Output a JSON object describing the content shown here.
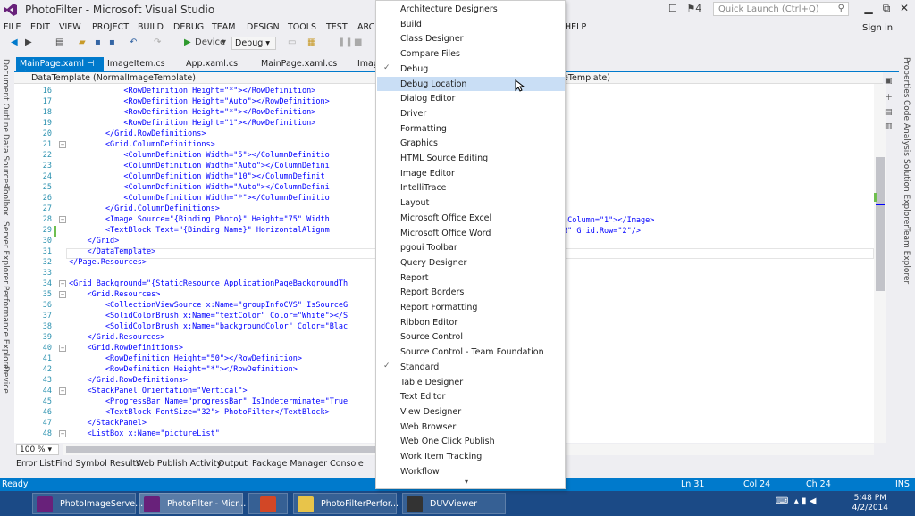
{
  "window": {
    "title": "PhotoFilter - Microsoft Visual Studio",
    "quick_launch_placeholder": "Quick Launch (Ctrl+Q)",
    "notif_count": "4",
    "sign_in": "Sign in",
    "minimize": "▁",
    "restore": "⧉",
    "close": "✕"
  },
  "menu": {
    "items": [
      "FILE",
      "EDIT",
      "VIEW",
      "PROJECT",
      "BUILD",
      "DEBUG",
      "TEAM",
      "DESIGN",
      "TOOLS",
      "TEST",
      "ARCH",
      "HELP"
    ]
  },
  "toolbar": {
    "device_label": "Device",
    "config_label": "Debug"
  },
  "left_tabs": [
    "Document Outline",
    "Data Sources",
    "Toolbox",
    "Server Explorer",
    "Performance Explorer",
    "Device"
  ],
  "right_tabs": [
    "Properties",
    "Code Analysis",
    "Solution Explorer",
    "Team Explorer"
  ],
  "doc_tabs": [
    {
      "label": "MainPage.xaml",
      "pin": "⊣ ✕",
      "active": true
    },
    {
      "label": "ImageItem.cs",
      "active": false
    },
    {
      "label": "App.xaml.cs",
      "active": false
    },
    {
      "label": "MainPage.xaml.cs",
      "active": false
    },
    {
      "label": "Imag",
      "active": false
    }
  ],
  "nav": {
    "left": "DataTemplate (NormalImageTemplate)",
    "right": "eTemplate)"
  },
  "code_lines": [
    {
      "n": "16",
      "t": "            <RowDefinition Height=\"*\"></RowDefinition>"
    },
    {
      "n": "17",
      "t": "            <RowDefinition Height=\"Auto\"></RowDefinition>"
    },
    {
      "n": "18",
      "t": "            <RowDefinition Height=\"*\"></RowDefinition>"
    },
    {
      "n": "19",
      "t": "            <RowDefinition Height=\"1\"></RowDefinition>"
    },
    {
      "n": "20",
      "t": "        </Grid.RowDefinitions>"
    },
    {
      "n": "21",
      "t": "        <Grid.ColumnDefinitions>"
    },
    {
      "n": "22",
      "t": "            <ColumnDefinition Width=\"5\"></ColumnDefinitio"
    },
    {
      "n": "23",
      "t": "            <ColumnDefinition Width=\"Auto\"></ColumnDefini"
    },
    {
      "n": "24",
      "t": "            <ColumnDefinition Width=\"10\"></ColumnDefinit"
    },
    {
      "n": "25",
      "t": "            <ColumnDefinition Width=\"Auto\"></ColumnDefini"
    },
    {
      "n": "26",
      "t": "            <ColumnDefinition Width=\"*\"></ColumnDefinitio"
    },
    {
      "n": "27",
      "t": "        </Grid.ColumnDefinitions>"
    },
    {
      "n": "28",
      "t": "        <Image Source=\"{Binding Photo}\" Height=\"75\" Width"
    },
    {
      "n": "29",
      "t": "        <TextBlock Text=\"{Binding Name}\" HorizontalAlignm"
    },
    {
      "n": "30",
      "t": "    </Grid>"
    },
    {
      "n": "31",
      "t": "    </DataTemplate>"
    },
    {
      "n": "32",
      "t": "</Page.Resources>"
    },
    {
      "n": "33",
      "t": ""
    },
    {
      "n": "34",
      "t": "<Grid Background=\"{StaticResource ApplicationPageBackgroundTh"
    },
    {
      "n": "35",
      "t": "    <Grid.Resources>"
    },
    {
      "n": "36",
      "t": "        <CollectionViewSource x:Name=\"groupInfoCVS\" IsSourceG"
    },
    {
      "n": "37",
      "t": "        <SolidColorBrush x:Name=\"textColor\" Color=\"White\"></S"
    },
    {
      "n": "38",
      "t": "        <SolidColorBrush x:Name=\"backgroundColor\" Color=\"Blac"
    },
    {
      "n": "39",
      "t": "    </Grid.Resources>"
    },
    {
      "n": "40",
      "t": "    <Grid.RowDefinitions>"
    },
    {
      "n": "41",
      "t": "        <RowDefinition Height=\"50\"></RowDefinition>"
    },
    {
      "n": "42",
      "t": "        <RowDefinition Height=\"*\"></RowDefinition>"
    },
    {
      "n": "43",
      "t": "    </Grid.RowDefinitions>"
    },
    {
      "n": "44",
      "t": "    <StackPanel Orientation=\"Vertical\">"
    },
    {
      "n": "45",
      "t": "        <ProgressBar Name=\"progressBar\" IsIndeterminate=\"True"
    },
    {
      "n": "46",
      "t": "        <TextBlock FontSize=\"32\"> PhotoFilter</TextBlock>"
    },
    {
      "n": "47",
      "t": "    </StackPanel>"
    },
    {
      "n": "48",
      "t": "    <ListBox x:Name=\"pictureList\""
    }
  ],
  "code_right": {
    "l28": ".Column=\"1\"></Image>",
    "l29": "3\" Grid.Row=\"2\"/>"
  },
  "zoom": "100 %",
  "bottom_tabs": [
    "Error List",
    "Find Symbol Results",
    "Web Publish Activity",
    "Output",
    "Package Manager Console"
  ],
  "status": {
    "ready": "Ready",
    "ln": "Ln 31",
    "col": "Col 24",
    "ch": "Ch 24",
    "ins": "INS"
  },
  "dropdown": {
    "items": [
      {
        "label": "Architecture Designers",
        "checked": false
      },
      {
        "label": "Build",
        "checked": false
      },
      {
        "label": "Class Designer",
        "checked": false
      },
      {
        "label": "Compare Files",
        "checked": false
      },
      {
        "label": "Debug",
        "checked": true
      },
      {
        "label": "Debug Location",
        "checked": false,
        "highlight": true
      },
      {
        "label": "Dialog Editor",
        "checked": false
      },
      {
        "label": "Driver",
        "checked": false
      },
      {
        "label": "Formatting",
        "checked": false
      },
      {
        "label": "Graphics",
        "checked": false
      },
      {
        "label": "HTML Source Editing",
        "checked": false
      },
      {
        "label": "Image Editor",
        "checked": false
      },
      {
        "label": "IntelliTrace",
        "checked": false
      },
      {
        "label": "Layout",
        "checked": false
      },
      {
        "label": "Microsoft Office Excel",
        "checked": false
      },
      {
        "label": "Microsoft Office Word",
        "checked": false
      },
      {
        "label": "pgoui Toolbar",
        "checked": false
      },
      {
        "label": "Query Designer",
        "checked": false
      },
      {
        "label": "Report",
        "checked": false
      },
      {
        "label": "Report Borders",
        "checked": false
      },
      {
        "label": "Report Formatting",
        "checked": false
      },
      {
        "label": "Ribbon Editor",
        "checked": false
      },
      {
        "label": "Source Control",
        "checked": false
      },
      {
        "label": "Source Control - Team Foundation",
        "checked": false
      },
      {
        "label": "Standard",
        "checked": true
      },
      {
        "label": "Table Designer",
        "checked": false
      },
      {
        "label": "Text Editor",
        "checked": false
      },
      {
        "label": "View Designer",
        "checked": false
      },
      {
        "label": "Web Browser",
        "checked": false
      },
      {
        "label": "Web One Click Publish",
        "checked": false
      },
      {
        "label": "Work Item Tracking",
        "checked": false
      },
      {
        "label": "Workflow",
        "checked": false
      }
    ],
    "more": "▾"
  },
  "taskbar": {
    "tasks": [
      {
        "label": "PhotoImageServe...",
        "color": "#68217a"
      },
      {
        "label": "PhotoFilter - Micr...",
        "color": "#68217a"
      },
      {
        "label": "",
        "color": "#d24726"
      },
      {
        "label": "PhotoFilterPerfor...",
        "color": "#e8c44a"
      },
      {
        "label": "DUVViewer",
        "color": "#333333"
      }
    ],
    "time": "5:48 PM",
    "date": "4/2/2014"
  },
  "colors": {
    "accent": "#007acc",
    "vs_purple": "#68217a",
    "taskbar": "#1b4a86",
    "highlight": "#c9def5"
  }
}
